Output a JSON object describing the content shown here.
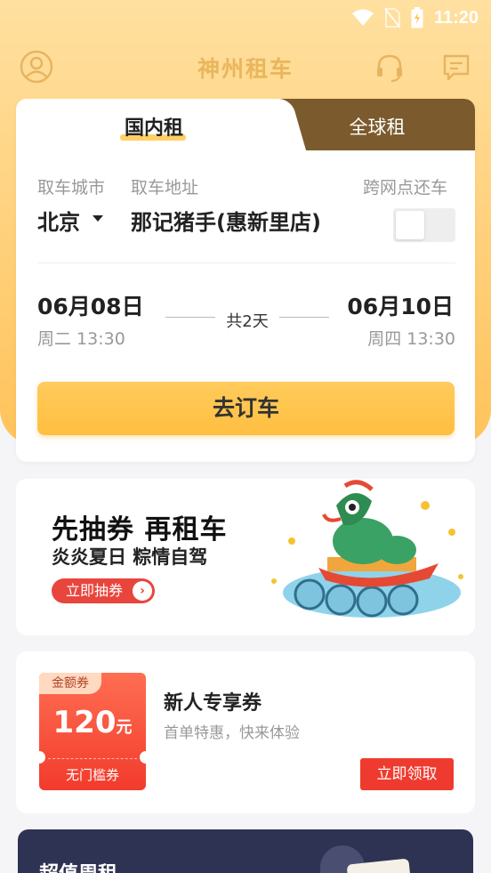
{
  "status_bar": {
    "time": "11:20"
  },
  "header": {
    "app_title": "神州租车"
  },
  "booking": {
    "tabs": [
      {
        "label": "国内租",
        "active": true
      },
      {
        "label": "全球租",
        "active": false
      }
    ],
    "pickup_city_label": "取车城市",
    "pickup_address_label": "取车地址",
    "cross_store_label": "跨网点还车",
    "city": "北京",
    "address": "那记猪手(惠新里店)",
    "cross_store_enabled": false,
    "pickup_date": "06月08日",
    "pickup_time": "周二 13:30",
    "duration": "共2天",
    "return_date": "06月10日",
    "return_time": "周四 13:30",
    "book_button": "去订车"
  },
  "promo": {
    "headline": "先抽券 再租车",
    "subline": "炎炎夏日 粽情自驾",
    "button": "立即抽券"
  },
  "coupon": {
    "tag": "金额券",
    "amount": "120",
    "unit": "元",
    "condition": "无门槛券",
    "title": "新人专享券",
    "subtitle": "首单特惠，快来体验",
    "claim_button": "立即领取"
  },
  "value_section": {
    "title": "超值周租"
  },
  "colors": {
    "brand_yellow": "#ffc84a",
    "tab_brown": "#7b5a2d",
    "red": "#ef3b2f",
    "navy": "#2f3353"
  }
}
